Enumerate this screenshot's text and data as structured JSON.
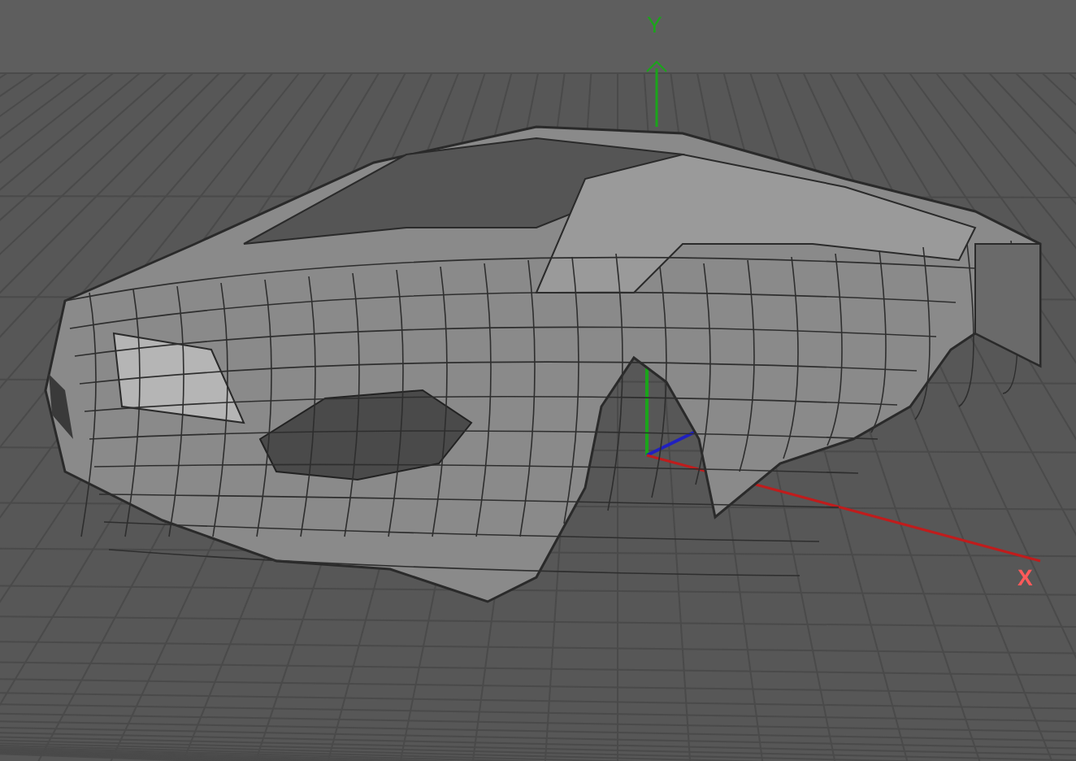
{
  "viewport": {
    "y_axis_label": "Y",
    "x_axis_label": "X"
  }
}
